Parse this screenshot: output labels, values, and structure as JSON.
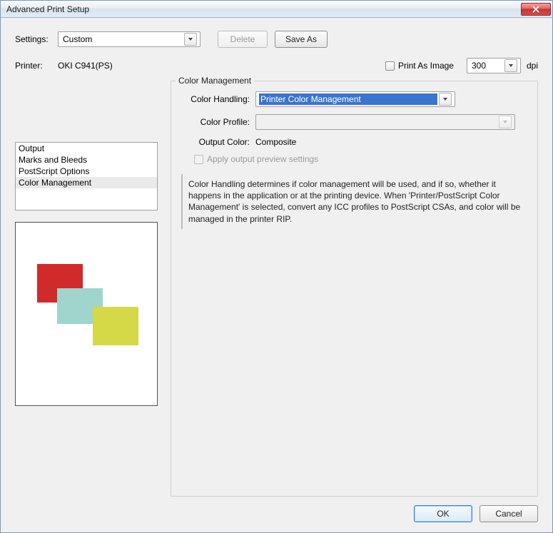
{
  "window": {
    "title": "Advanced Print Setup"
  },
  "settings": {
    "label": "Settings:",
    "value": "Custom",
    "delete_label": "Delete",
    "saveas_label": "Save As"
  },
  "printer": {
    "label": "Printer:",
    "value": "OKI C941(PS)",
    "print_as_image_label": "Print As Image",
    "dpi_value": "300",
    "dpi_unit": "dpi"
  },
  "sidebar": {
    "items": [
      {
        "label": "Output"
      },
      {
        "label": "Marks and Bleeds"
      },
      {
        "label": "PostScript Options"
      },
      {
        "label": "Color Management"
      }
    ],
    "selected_index": 3
  },
  "group": {
    "title": "Color Management",
    "color_handling_label": "Color Handling:",
    "color_handling_value": "Printer Color Management",
    "color_profile_label": "Color Profile:",
    "color_profile_value": "",
    "output_color_label": "Output Color:",
    "output_color_value": "Composite",
    "apply_preview_label": "Apply output preview settings",
    "help_text": "Color Handling determines if color management will be used, and if so, whether it happens in the application or at the printing device. When 'Printer/PostScript Color Management' is selected, convert any ICC profiles to PostScript CSAs, and color will be managed in the printer RIP."
  },
  "footer": {
    "ok_label": "OK",
    "cancel_label": "Cancel"
  }
}
